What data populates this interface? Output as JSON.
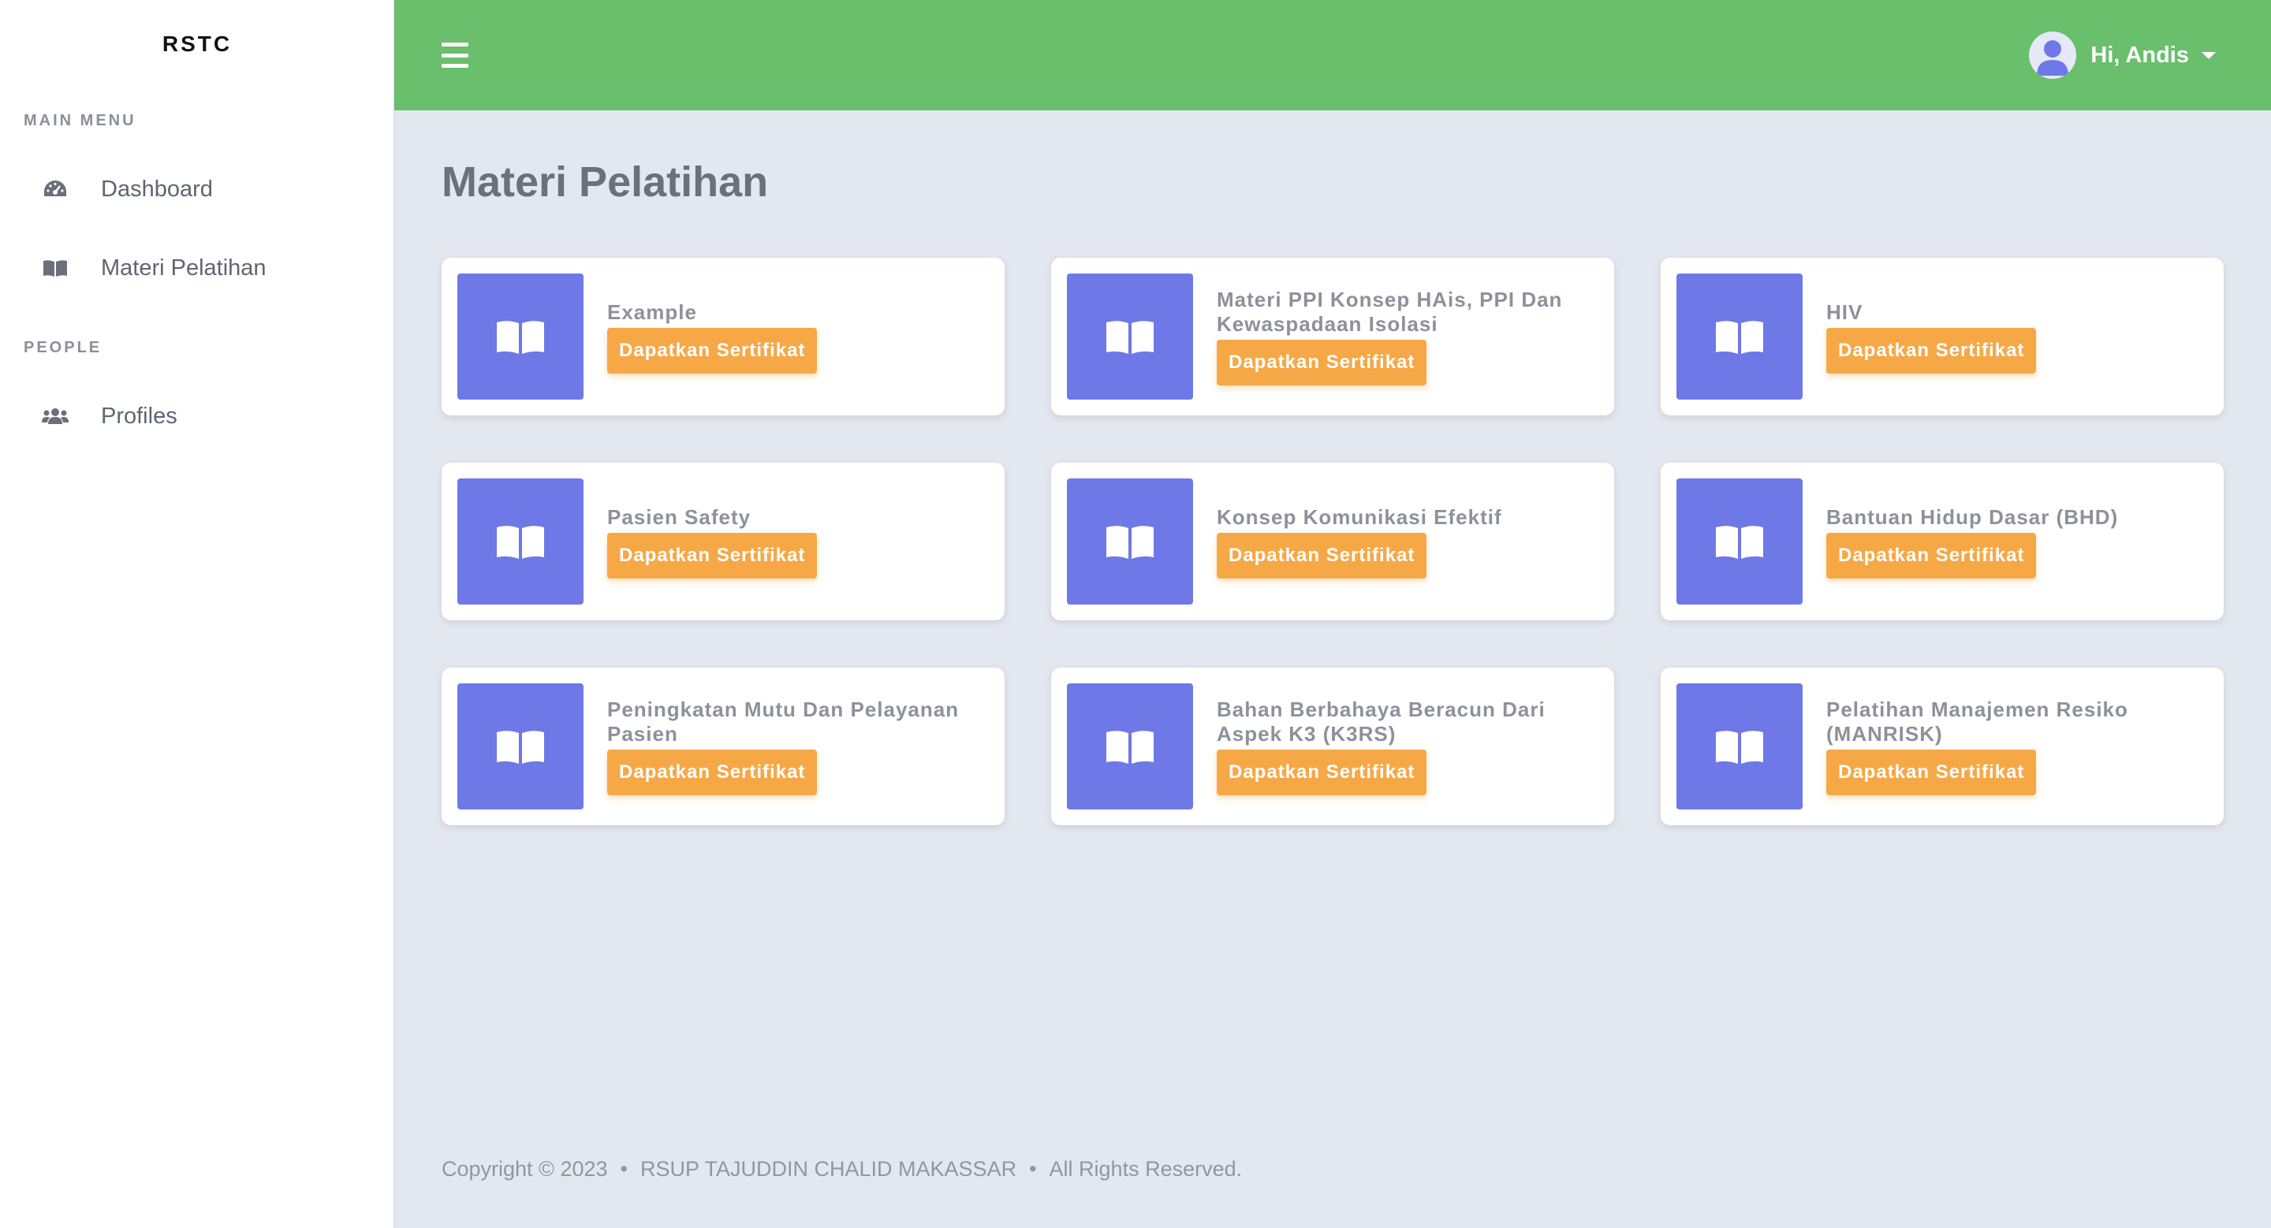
{
  "sidebar": {
    "brand": "RSTC",
    "sections": [
      {
        "label": "MAIN MENU",
        "items": [
          {
            "label": "Dashboard",
            "icon": "dashboard-icon"
          },
          {
            "label": "Materi Pelatihan",
            "icon": "book-icon"
          }
        ]
      },
      {
        "label": "PEOPLE",
        "items": [
          {
            "label": "Profiles",
            "icon": "users-icon"
          }
        ]
      }
    ]
  },
  "topbar": {
    "menu_icon": "hamburger-icon",
    "greeting": "Hi, Andis",
    "avatar_icon": "user-avatar-icon"
  },
  "main": {
    "title": "Materi Pelatihan",
    "cards": [
      {
        "title": "Example",
        "button": "Dapatkan Sertifikat"
      },
      {
        "title": "Materi PPI Konsep HAis, PPI Dan Kewaspadaan Isolasi",
        "button": "Dapatkan Sertifikat"
      },
      {
        "title": "HIV",
        "button": "Dapatkan Sertifikat"
      },
      {
        "title": "Pasien Safety",
        "button": "Dapatkan Sertifikat"
      },
      {
        "title": "Konsep Komunikasi Efektif",
        "button": "Dapatkan Sertifikat"
      },
      {
        "title": "Bantuan Hidup Dasar (BHD)",
        "button": "Dapatkan Sertifikat"
      },
      {
        "title": "Peningkatan Mutu Dan Pelayanan Pasien",
        "button": "Dapatkan Sertifikat"
      },
      {
        "title": "Bahan Berbahaya Beracun Dari Aspek K3 (K3RS)",
        "button": "Dapatkan Sertifikat"
      },
      {
        "title": "Pelatihan Manajemen Resiko (MANRISK)",
        "button": "Dapatkan Sertifikat"
      }
    ]
  },
  "footer": {
    "copyright": "Copyright © 2023",
    "org": "RSUP TAJUDDIN CHALID MAKASSAR",
    "rights": "All Rights Reserved."
  },
  "colors": {
    "topbar": "#6abf6c",
    "card_thumb": "#6e78e6",
    "button": "#f6a847",
    "background": "#e3e7ef"
  }
}
